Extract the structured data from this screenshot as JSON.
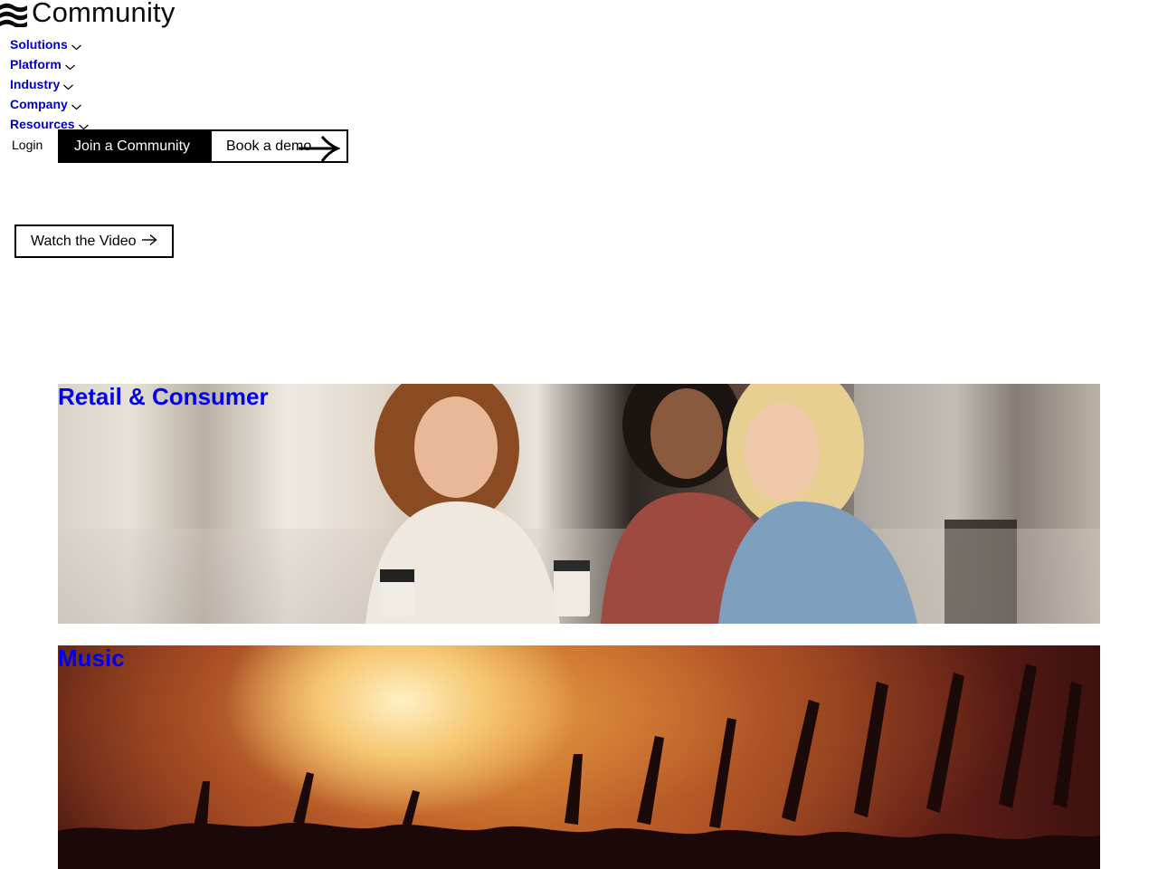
{
  "brand": {
    "logo_text": "Community"
  },
  "nav": {
    "items": [
      {
        "label": "Solutions"
      },
      {
        "label": "Platform"
      },
      {
        "label": "Industry"
      },
      {
        "label": "Company"
      },
      {
        "label": "Resources"
      }
    ]
  },
  "header_actions": {
    "login_label": "Login",
    "join_label": "Join a Community",
    "demo_label": "Book a demo"
  },
  "hero": {
    "watch_label": "Watch the Video"
  },
  "industries": [
    {
      "title": "Retail & Consumer"
    },
    {
      "title": "Music"
    }
  ],
  "colors": {
    "link": "#0000ee",
    "nav_link": "#0000cc",
    "button_dark": "#000000",
    "button_light": "#ffffff"
  },
  "icons": {
    "logo": "wave-lines-icon",
    "nav_chevron": "chevron-down-icon",
    "arrow": "arrow-right-icon"
  }
}
